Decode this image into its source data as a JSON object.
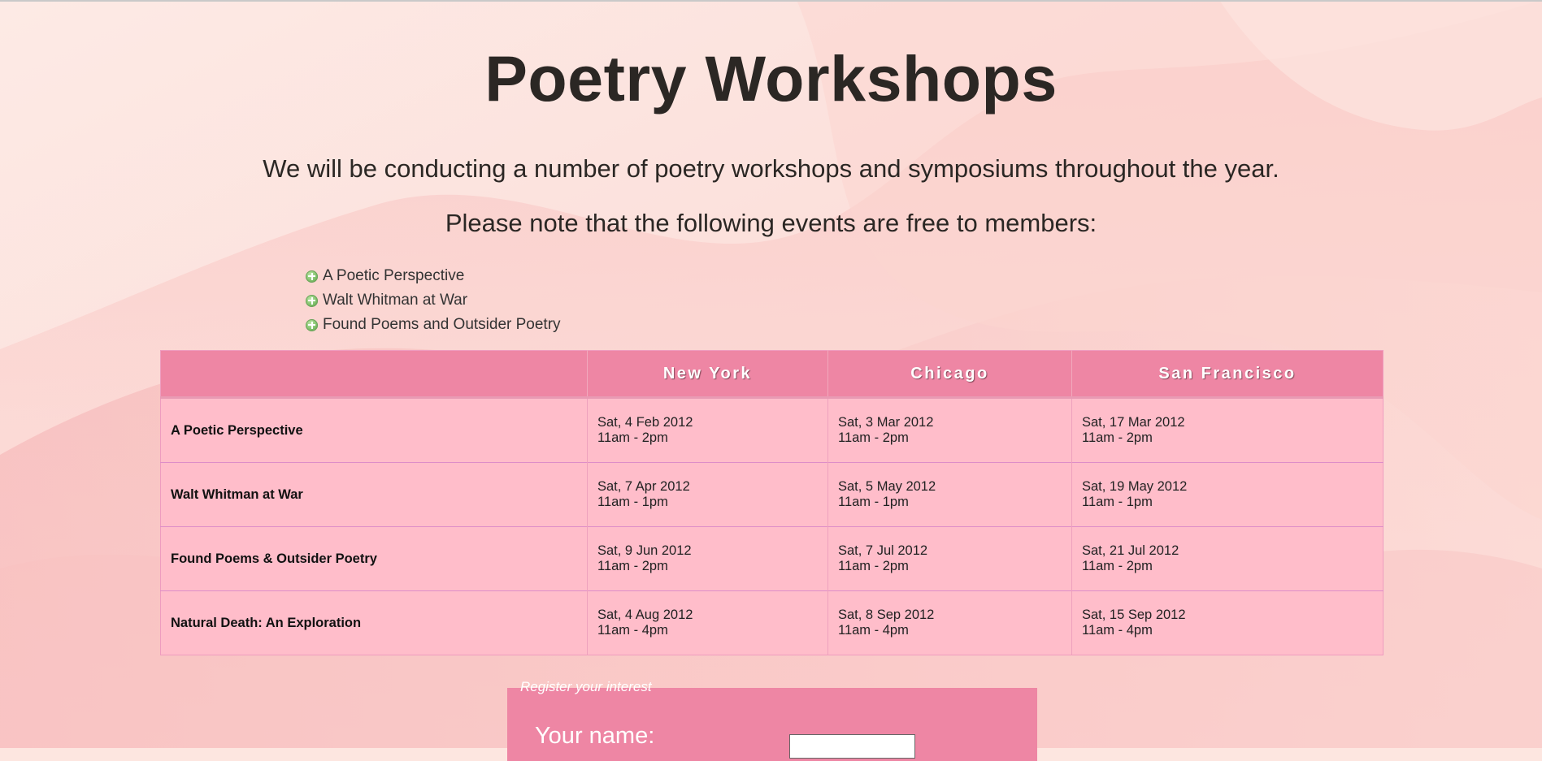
{
  "page": {
    "title": "Poetry Workshops",
    "intro_line1": "We will be conducting a number of poetry workshops and symposiums throughout the year.",
    "intro_line2": "Please note that the following events are free to members:"
  },
  "free_events": [
    "A Poetic Perspective",
    "Walt Whitman at War",
    "Found Poems and Outsider Poetry"
  ],
  "schedule": {
    "columns": [
      "",
      "New York",
      "Chicago",
      "San Francisco"
    ],
    "rows": [
      {
        "name": "A Poetic Perspective",
        "cells": [
          {
            "date": "Sat, 4 Feb 2012",
            "time": "11am - 2pm"
          },
          {
            "date": "Sat, 3 Mar 2012",
            "time": "11am - 2pm"
          },
          {
            "date": "Sat, 17 Mar 2012",
            "time": "11am - 2pm"
          }
        ]
      },
      {
        "name": "Walt Whitman at War",
        "cells": [
          {
            "date": "Sat, 7 Apr 2012",
            "time": "11am - 1pm"
          },
          {
            "date": "Sat, 5 May 2012",
            "time": "11am - 1pm"
          },
          {
            "date": "Sat, 19 May 2012",
            "time": "11am - 1pm"
          }
        ]
      },
      {
        "name": "Found Poems & Outsider Poetry",
        "cells": [
          {
            "date": "Sat, 9 Jun 2012",
            "time": "11am - 2pm"
          },
          {
            "date": "Sat, 7 Jul 2012",
            "time": "11am - 2pm"
          },
          {
            "date": "Sat, 21 Jul 2012",
            "time": "11am - 2pm"
          }
        ]
      },
      {
        "name": "Natural Death: An Exploration",
        "cells": [
          {
            "date": "Sat, 4 Aug 2012",
            "time": "11am - 4pm"
          },
          {
            "date": "Sat, 8 Sep 2012",
            "time": "11am - 4pm"
          },
          {
            "date": "Sat, 15 Sep 2012",
            "time": "11am - 4pm"
          }
        ]
      }
    ]
  },
  "register": {
    "legend": "Register your interest",
    "name_label": "Your name:",
    "name_value": ""
  },
  "colors": {
    "background": "#fde6e0",
    "table_header": "#ee86a4",
    "table_body": "#ffbdca",
    "form_box": "#ee86a4"
  },
  "icons": {
    "bullet": "plus-circle-icon"
  }
}
